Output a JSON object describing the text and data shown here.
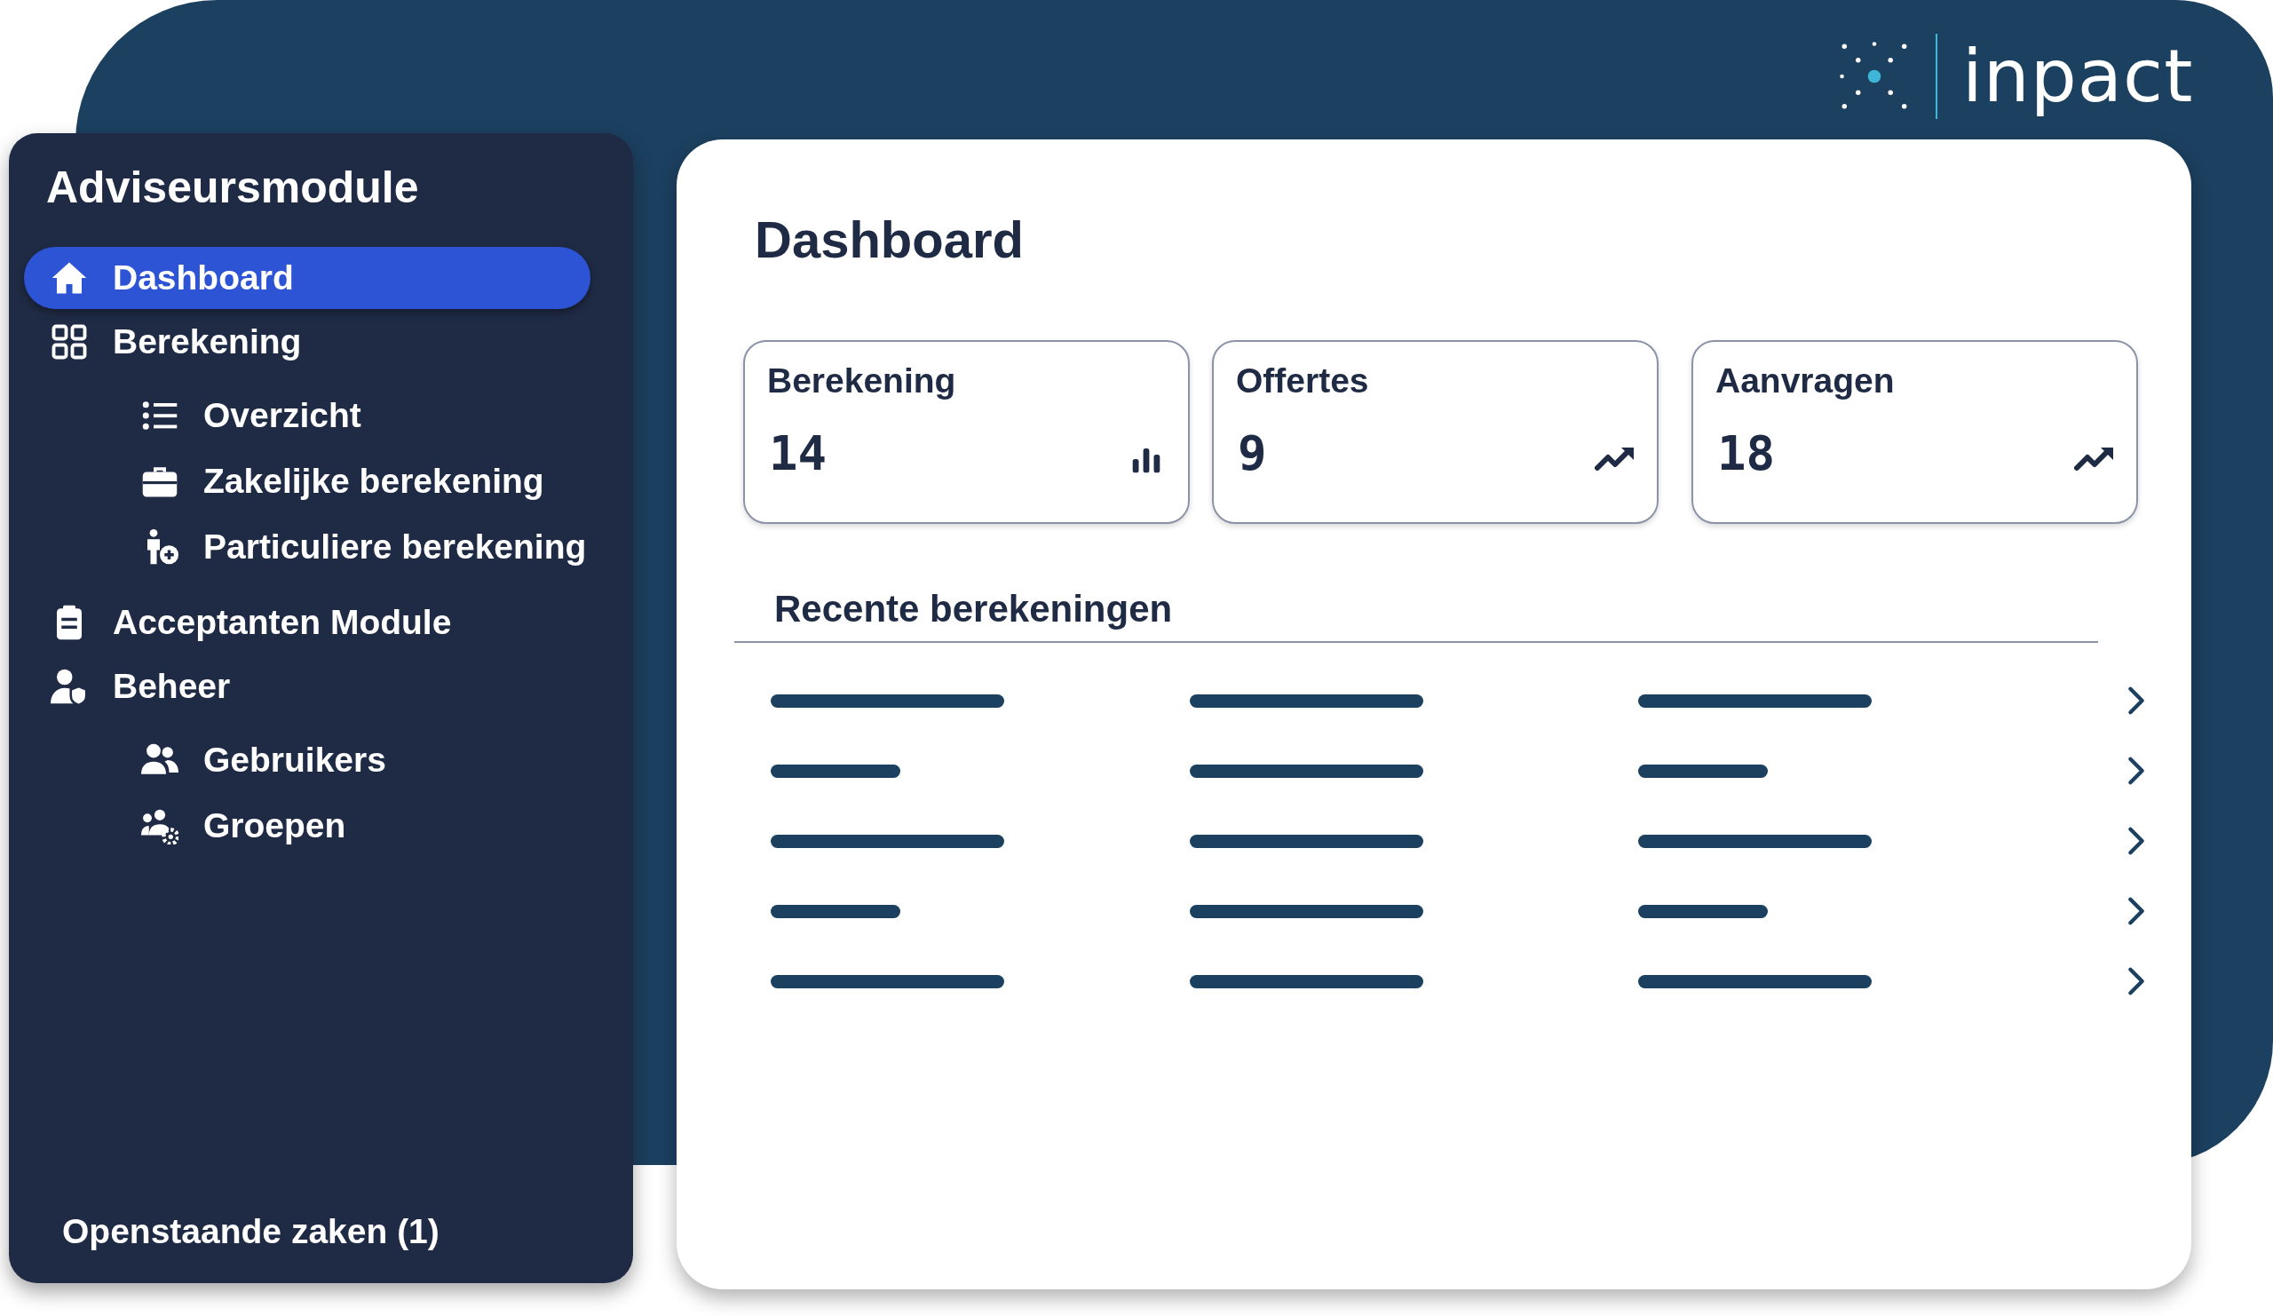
{
  "logo": {
    "text": "inpact"
  },
  "sidebar": {
    "title": "Adviseursmodule",
    "items": [
      {
        "label": "Dashboard",
        "selected": true
      },
      {
        "label": "Berekening",
        "selected": false,
        "children": [
          {
            "label": "Overzicht",
            "selected": false
          },
          {
            "label": "Zakelijke berekening",
            "selected": false
          },
          {
            "label": "Particuliere berekening",
            "selected": false
          }
        ]
      },
      {
        "label": "Acceptanten Module",
        "selected": false
      },
      {
        "label": "Beheer",
        "selected": false,
        "children": [
          {
            "label": "Gebruikers",
            "selected": false
          },
          {
            "label": "Groepen",
            "selected": false
          }
        ]
      }
    ],
    "footer": "Openstaande zaken (1)"
  },
  "main": {
    "title": "Dashboard",
    "stats": [
      {
        "label": "Berekening",
        "value": "14",
        "kind": "bars"
      },
      {
        "label": "Offertes",
        "value": "9",
        "kind": "trend"
      },
      {
        "label": "Aanvragen",
        "value": "18",
        "kind": "trend"
      }
    ],
    "recent": {
      "title": "Recente berekeningen",
      "rows": [
        {
          "bars": [
            {
              "short": false
            },
            {
              "short": false
            },
            {
              "short": false
            }
          ]
        },
        {
          "bars": [
            {
              "short": true
            },
            {
              "short": false
            },
            {
              "short": true
            }
          ]
        },
        {
          "bars": [
            {
              "short": false
            },
            {
              "short": false
            },
            {
              "short": false
            }
          ]
        },
        {
          "bars": [
            {
              "short": true
            },
            {
              "short": false
            },
            {
              "short": true
            }
          ]
        },
        {
          "bars": [
            {
              "short": false
            },
            {
              "short": false
            },
            {
              "short": false
            }
          ]
        }
      ]
    }
  }
}
